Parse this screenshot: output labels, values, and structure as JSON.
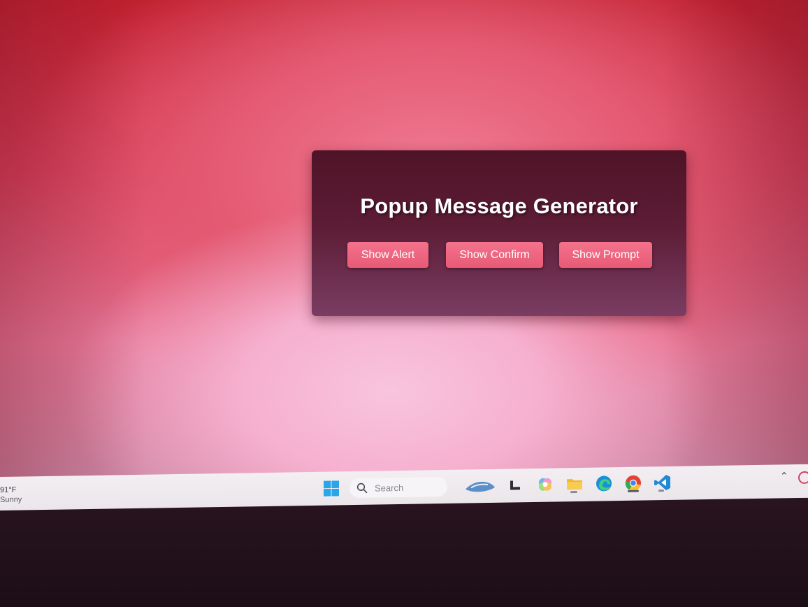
{
  "app": {
    "title": "Popup Message Generator"
  },
  "buttons": {
    "alert_label": "Show Alert",
    "confirm_label": "Show Confirm",
    "prompt_label": "Show Prompt"
  },
  "taskbar": {
    "weather_temp": "91°F",
    "weather_condition": "Sunny",
    "search_placeholder": "Search",
    "pinned_apps": [
      "start-icon",
      "search-icon",
      "widget-icon",
      "task-view-icon",
      "copilot-icon",
      "file-explorer-icon",
      "edge-icon",
      "chrome-icon",
      "vscode-icon"
    ]
  },
  "colors": {
    "panel": "#5c1c35",
    "button": "#ee6680",
    "background": "#e45a72"
  }
}
